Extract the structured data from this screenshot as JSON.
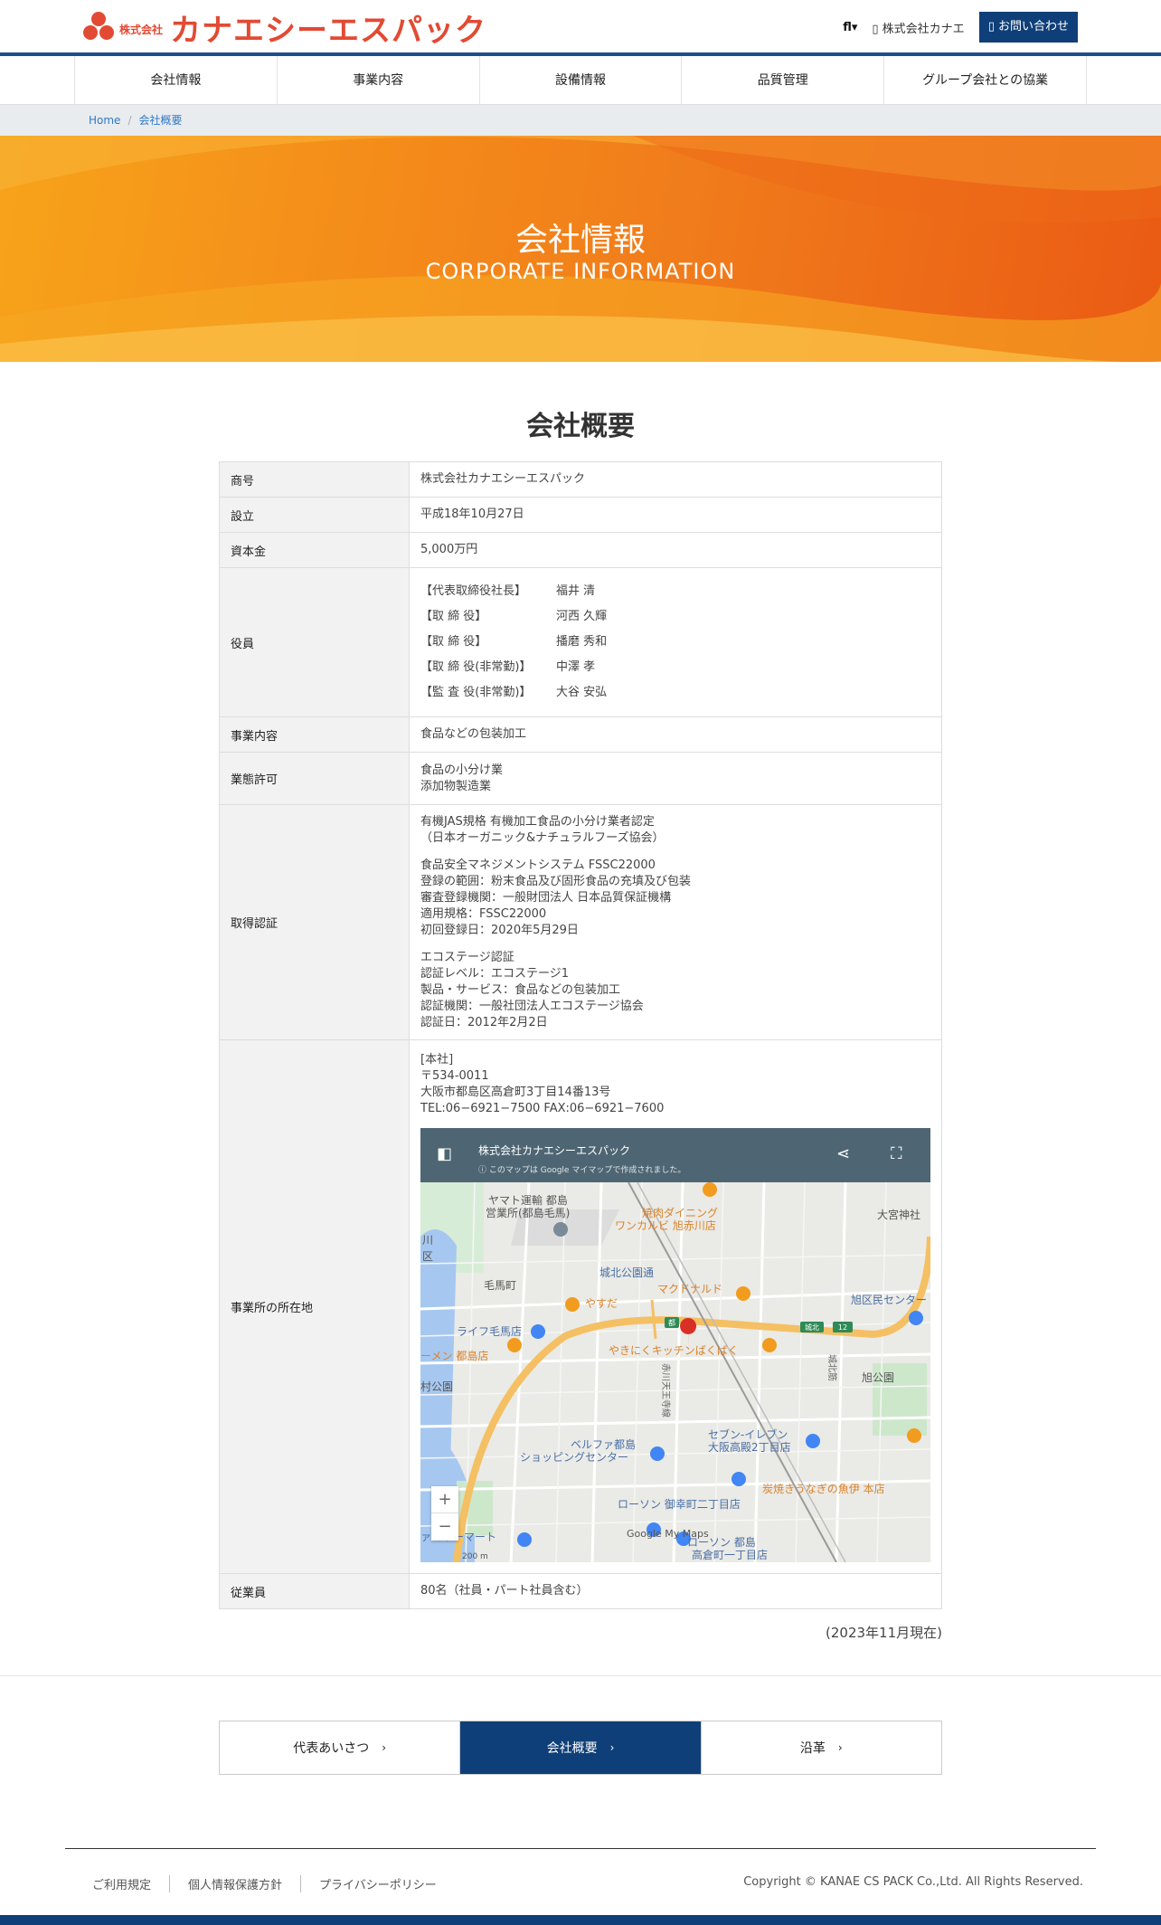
{
  "header": {
    "logo_prefix": "株式会社",
    "logo_name": "カナエシーエスパック",
    "lang_label": "fl▾",
    "company_link": "株式会社カナエ",
    "contact_label": "お問い合わせ"
  },
  "nav": {
    "items": [
      "会社情報",
      "事業内容",
      "設備情報",
      "品質管理",
      "グループ会社との協業"
    ]
  },
  "breadcrumb": {
    "home": "Home",
    "separator": "/",
    "current": "会社概要"
  },
  "hero": {
    "title": "会社情報",
    "subtitle": "CORPORATE INFORMATION"
  },
  "section": {
    "title": "会社概要"
  },
  "profile": {
    "trade_name_label": "商号",
    "trade_name": "株式会社カナエシーエスパック",
    "founded_label": "設立",
    "founded": "平成18年10月27日",
    "capital_label": "資本金",
    "capital": "5,000万円",
    "officers_label": "役員",
    "officers": [
      {
        "role": "【代表取締役社長】",
        "name": "福井 清"
      },
      {
        "role": "【取 締 役】",
        "name": "河西 久輝"
      },
      {
        "role": "【取 締 役】",
        "name": "播磨 秀和"
      },
      {
        "role": "【取 締 役(非常勤)】",
        "name": "中澤 孝"
      },
      {
        "role": "【監 査 役(非常勤)】",
        "name": "大谷 安弘"
      }
    ],
    "business_label": "事業内容",
    "business": "食品などの包装加工",
    "license_label": "業態許可",
    "license_1": "食品の小分け業",
    "license_2": "添加物製造業",
    "cert_label": "取得認証",
    "cert_a1": "有機JAS規格 有機加工食品の小分け業者認定",
    "cert_a2": "（日本オーガニック&ナチュラルフーズ協会）",
    "cert_b1": "食品安全マネジメントシステム FSSC22000",
    "cert_b2": "登録の範囲：粉末食品及び固形食品の充填及び包装",
    "cert_b3": "審査登録機関：一般財団法人 日本品質保証機構",
    "cert_b4": "適用規格：FSSC22000",
    "cert_b5": "初回登録日：2020年5月29日",
    "cert_c1": "エコステージ認証",
    "cert_c2": "認証レベル：エコステージ1",
    "cert_c3": "製品・サービス：食品などの包装加工",
    "cert_c4": "認証機関：一般社団法人エコステージ協会",
    "cert_c5": "認証日：2012年2月2日",
    "location_label": "事業所の所在地",
    "loc_office": "[本社]",
    "loc_zip": "〒534-0011",
    "loc_address": "大阪市都島区高倉町3丁目14番13号",
    "loc_tel": "TEL:06−6921−7500 FAX:06−6921−7600",
    "employees_label": "従業員",
    "employees": "80名（社員・パート社員含む）"
  },
  "map": {
    "header_title": "株式会社カナエシーエスパック",
    "header_note": "このマップは Google マイマップで作成されました。",
    "labels": {
      "yamato": "ヤマト運輸 都島",
      "yamato2": "営業所(都島毛馬)",
      "yakiniku": "焼肉ダイニング",
      "wankarubi": "ワンカルビ 旭赤川店",
      "omiya": "大宮神社",
      "kawachi": "川",
      "kawachi2": "区",
      "kema": "毛馬町",
      "jokita": "城北公園通",
      "mcd": "マクドナルド",
      "asahi": "旭区民センター",
      "yasuda": "やすだ",
      "life": "ライフ毛馬店",
      "ramen": "ーメン 都島店",
      "yakiniku2": "やきにくキッチンばくばく",
      "mura": "村公園",
      "akagawa": "赤川天王寺線",
      "jokita2": "城北筋",
      "asahi2": "旭公園",
      "seven": "セブン-イレブン",
      "seven2": "大阪高殿2丁目店",
      "belfa": "ベルファ都島",
      "belfa2": "ショッピングセンター",
      "unagi": "炭焼きうなぎの魚伊 本店",
      "lawson1": "ローソン 御幸町二丁目店",
      "family": "ァミリーマート",
      "lawson2": "ローソン 都島",
      "lawson3": "高倉町一丁目店",
      "google": "Google My Maps",
      "scale": "200 m",
      "road12": "12",
      "roadjo": "城北",
      "roadto": "都"
    },
    "zoom_in": "+",
    "zoom_out": "−"
  },
  "as_of": "(2023年11月現在)",
  "subnav": [
    {
      "label": "代表あいさつ",
      "arrow": "›"
    },
    {
      "label": "会社概要",
      "arrow": "›"
    },
    {
      "label": "沿革",
      "arrow": "›"
    }
  ],
  "footer": {
    "links": [
      "ご利用規定",
      "個人情報保護方針",
      "プライバシーポリシー"
    ],
    "copyright": "Copyright © KANAE CS PACK Co.,Ltd. All Rights Reserved."
  },
  "colors": {
    "brand_red": "#e24a33",
    "navy": "#0f3f78",
    "hero_orange": "#f48a1a"
  }
}
